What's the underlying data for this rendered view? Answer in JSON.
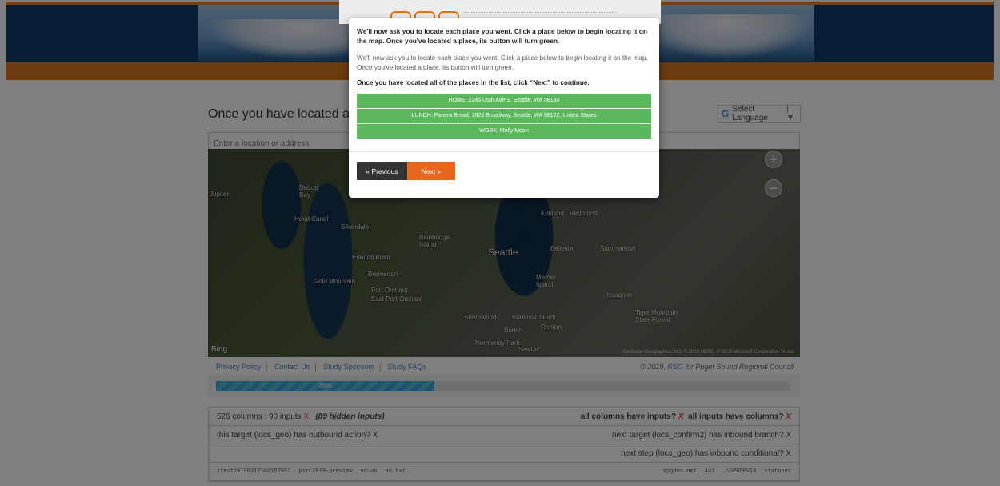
{
  "page": {
    "heading": "Once you have located all of",
    "language_label": "Select Language",
    "location_placeholder": "Enter a location or address"
  },
  "map": {
    "labels": [
      "Seattle",
      "Bellevue",
      "Kirkland · Redmond",
      "Sammamish",
      "Bremerton",
      "Port Orchard",
      "East Port Orchard",
      "Bainbridge Island",
      "Mercer Island",
      "Issaquah",
      "Renton",
      "Burien",
      "Shorewood",
      "Boulevard Park",
      "Normandy Park",
      "SeaTac",
      "Silverdale",
      "Erlands Point",
      "Hood Canal",
      "Dabob Bay",
      "Gold Mountain",
      "Tiger Mountain State Forest",
      "Jupiter"
    ],
    "attribution": "Earthstar Geographics SIO, © 2019 HERE, © 2019 Microsoft Corporation Terms",
    "brand": "Bing"
  },
  "footer": {
    "links": [
      "Privacy Policy",
      "Contact Us",
      "Study Sponsors",
      "Study FAQs"
    ],
    "copyright_prefix": "© 2019,",
    "copyright_link": "RSG",
    "copyright_suffix": "for Puget Sound Regional Council"
  },
  "progress": {
    "percent": 38,
    "label": "38%"
  },
  "debug": {
    "columns_text": "526 columns : 90 inputs",
    "hidden_text": "(89 hidden inputs)",
    "check_columns": "all columns have inputs?",
    "check_inputs": "all inputs have columns?",
    "outbound": "this target (locs_geo) has outbound action?",
    "inbound_branch": "next target (locs_confirm2) has inbound branch?",
    "inbound_conditional": "next step (locs_geo) has inbound conditional?",
    "x_mark": "X",
    "meta_left": [
      "itest20190312160152957",
      "psrc2019-preview",
      "en-us",
      "en.txt"
    ],
    "meta_right": [
      "spgdev.net",
      "443",
      ".\\SPGDEV14",
      "statuses"
    ]
  },
  "modal": {
    "question": "We'll now ask you to locate each place you went. Click a place below to begin locating it on the map. Once you've located a place, its button will turn green.",
    "description": "We'll now ask you to locate each place you went. Click a place below to begin locating it on the map. Once you've located a place, its button will turn green.",
    "instruction": "Once you have located all of the places in the list, click “Next” to continue.",
    "places": [
      "HOME: 2245 Utah Ave S, Seattle, WA 98134",
      "LUNCH: Panera Bread, 1620 Broadway, Seattle, WA 98122, United States",
      "WORK: Molly Moon"
    ],
    "prev_label": "« Previous",
    "next_label": "Next »"
  }
}
